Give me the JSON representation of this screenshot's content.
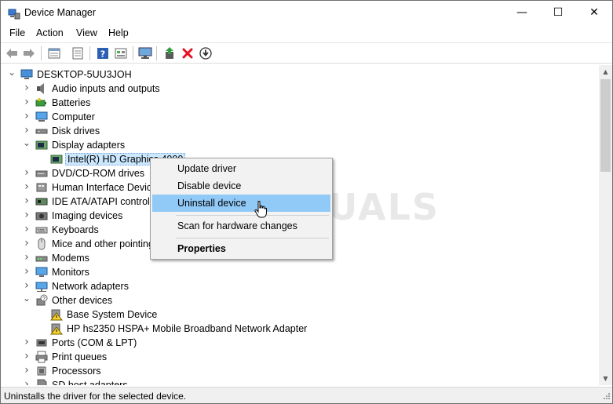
{
  "window": {
    "title": "Device Manager"
  },
  "caption": {
    "minimize": "—",
    "maximize": "☐",
    "close": "✕"
  },
  "menu": [
    "File",
    "Action",
    "View",
    "Help"
  ],
  "toolbar": {
    "back": "back-arrow-icon",
    "forward": "forward-arrow-icon",
    "properties": "properties-icon",
    "scan": "scan-icon",
    "help": "help-icon",
    "update_driver": "update-driver-icon",
    "uninstall": "uninstall-red-x-icon",
    "download": "download-icon"
  },
  "tree": {
    "root": "DESKTOP-5UU3JOH",
    "items": [
      {
        "label": "Audio inputs and outputs",
        "expanded": false,
        "icon": "speaker-icon"
      },
      {
        "label": "Batteries",
        "expanded": false,
        "icon": "battery-icon"
      },
      {
        "label": "Computer",
        "expanded": false,
        "icon": "computer-icon"
      },
      {
        "label": "Disk drives",
        "expanded": false,
        "icon": "disk-icon"
      },
      {
        "label": "Display adapters",
        "expanded": true,
        "icon": "display-adapter-icon",
        "children": [
          {
            "label": "Intel(R) HD Graphics 4000",
            "selected": true,
            "icon": "display-adapter-icon"
          }
        ]
      },
      {
        "label": "DVD/CD-ROM drives",
        "expanded": false,
        "icon": "dvd-icon"
      },
      {
        "label": "Human Interface Devices",
        "expanded": false,
        "icon": "hid-icon"
      },
      {
        "label": "IDE ATA/ATAPI controllers",
        "expanded": false,
        "icon": "ide-icon"
      },
      {
        "label": "Imaging devices",
        "expanded": false,
        "icon": "camera-icon"
      },
      {
        "label": "Keyboards",
        "expanded": false,
        "icon": "keyboard-icon"
      },
      {
        "label": "Mice and other pointing devices",
        "expanded": false,
        "icon": "mouse-icon"
      },
      {
        "label": "Modems",
        "expanded": false,
        "icon": "modem-icon"
      },
      {
        "label": "Monitors",
        "expanded": false,
        "icon": "monitor-icon"
      },
      {
        "label": "Network adapters",
        "expanded": false,
        "icon": "network-icon"
      },
      {
        "label": "Other devices",
        "expanded": true,
        "icon": "unknown-device-icon",
        "children": [
          {
            "label": "Base System Device",
            "icon": "warning-device-icon"
          },
          {
            "label": "HP hs2350 HSPA+ Mobile Broadband Network Adapter",
            "icon": "warning-device-icon"
          }
        ]
      },
      {
        "label": "Ports (COM & LPT)",
        "expanded": false,
        "icon": "port-icon"
      },
      {
        "label": "Print queues",
        "expanded": false,
        "icon": "printer-icon"
      },
      {
        "label": "Processors",
        "expanded": false,
        "icon": "processor-icon"
      },
      {
        "label": "SD host adapters",
        "expanded": false,
        "icon": "sd-icon"
      }
    ]
  },
  "context_menu": {
    "items": [
      {
        "label": "Update driver"
      },
      {
        "label": "Disable device"
      },
      {
        "label": "Uninstall device",
        "highlighted": true
      },
      {
        "label": "Scan for hardware changes"
      },
      {
        "label": "Properties",
        "bold": true
      }
    ]
  },
  "watermark": "APPUALS",
  "status": {
    "text": "Uninstalls the driver for the selected device."
  },
  "colors": {
    "selection": "#cce8ff",
    "menu_hover": "#91c9f7",
    "uninstall_red": "#e81123",
    "scrollbar_thumb": "#cdcdcd"
  }
}
